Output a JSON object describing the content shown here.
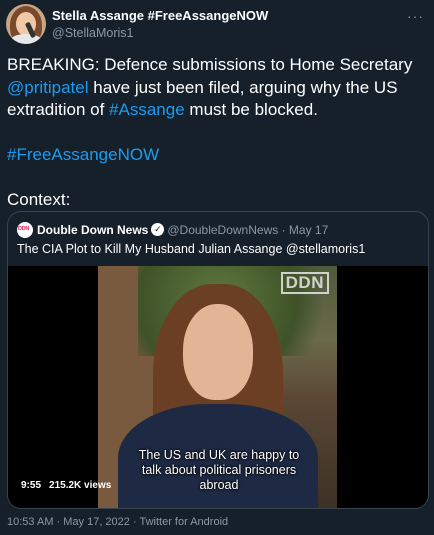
{
  "author": {
    "name": "Stella Assange #FreeAssangeNOW",
    "handle": "@StellaMoris1"
  },
  "more_icon": "ellipsis-icon",
  "tweet": {
    "line1_prefix": "BREAKING: Defence submissions to Home Secretary",
    "mention": "@pritipatel",
    "line2_suffix": " have just been filed, arguing why the US extradition of ",
    "hashtag_assange": "#Assange",
    "line3_suffix": " must be blocked.",
    "hashtag_free": "#FreeAssangeNOW",
    "context": "Context:"
  },
  "quote": {
    "name": "Double Down News",
    "handle_time": "@DoubleDownNews · May 17",
    "title": "The CIA Plot to Kill My Husband Julian Assange @stellamoris1",
    "logo_text": "DDN",
    "video": {
      "watermark": "DDN",
      "caption": "The US and UK are happy to talk about political prisoners abroad",
      "duration": "9:55",
      "views": "215.2K views"
    }
  },
  "footer": "10:53 AM · May 17, 2022 · Twitter for Android",
  "colors": {
    "background": "#15202b",
    "link": "#1d9bf0",
    "secondary_text": "#8b98a5",
    "border": "#38444d"
  }
}
